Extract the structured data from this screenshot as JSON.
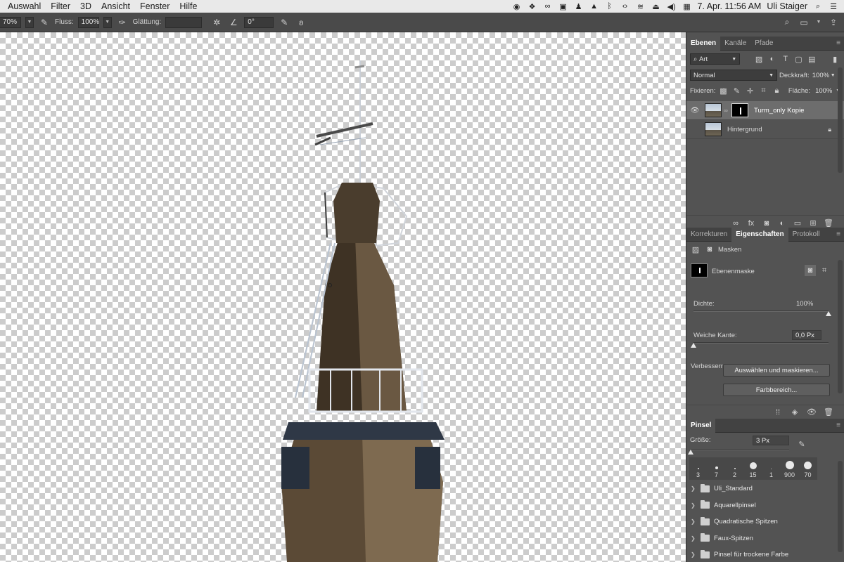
{
  "menubar": {
    "menus": [
      "Auswahl",
      "Filter",
      "3D",
      "Ansicht",
      "Fenster",
      "Hilfe"
    ],
    "datetime": "7. Apr.  11:56 AM",
    "user": "Uli Staiger"
  },
  "options": {
    "opacity_value": "70%",
    "flow_label": "Fluss:",
    "flow_value": "100%",
    "smoothing_label": "Glättung:",
    "smoothing_value": "",
    "angle_value": "0°"
  },
  "layers_panel": {
    "tabs": [
      "Ebenen",
      "Kanäle",
      "Pfade"
    ],
    "filter_value": "Art",
    "blend_mode": "Normal",
    "opacity_label": "Deckkraft:",
    "opacity_value": "100%",
    "lock_label": "Fixieren:",
    "fill_label": "Fläche:",
    "fill_value": "100%",
    "layers": [
      {
        "name": "Turm_only Kopie",
        "selected": true
      },
      {
        "name": "Hintergrund",
        "selected": false
      }
    ]
  },
  "properties_panel": {
    "tabs": [
      "Korrekturen",
      "Eigenschaften",
      "Protokoll"
    ],
    "section_label": "Masken",
    "mask_title": "Ebenenmaske",
    "density_label": "Dichte:",
    "density_value": "100%",
    "density_level": 1.0,
    "feather_label": "Weiche Kante:",
    "feather_value": "0,0 Px",
    "feather_level": 0.0,
    "refine_label": "Verbessern:",
    "select_mask_button": "Auswählen und maskieren...",
    "color_range_button": "Farbbereich..."
  },
  "brush_panel": {
    "tab": "Pinsel",
    "size_label": "Größe:",
    "size_value": "3 Px",
    "size_level": 0.0,
    "tips": [
      "3",
      "7",
      "2",
      "15",
      "1",
      "900",
      "70"
    ],
    "folders": [
      "Uli_Standard",
      "Aquarellpinsel",
      "Quadratische Spitzen",
      "Faux-Spitzen",
      "Pinsel für trockene Farbe"
    ]
  }
}
